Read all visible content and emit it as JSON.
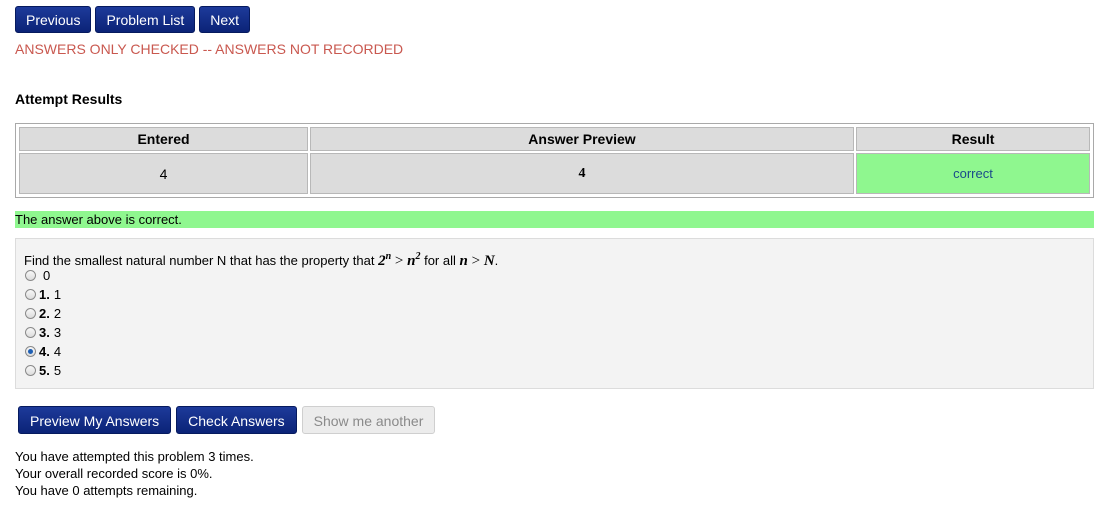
{
  "nav": {
    "previous_label": "Previous",
    "problem_list_label": "Problem List",
    "next_label": "Next"
  },
  "warning_text": "ANSWERS ONLY CHECKED -- ANSWERS NOT RECORDED",
  "results": {
    "title": "Attempt Results",
    "headers": {
      "entered": "Entered",
      "preview": "Answer Preview",
      "result": "Result"
    },
    "row": {
      "entered": "4",
      "preview": "4",
      "result": "correct"
    }
  },
  "correct_banner": "The answer above is correct.",
  "problem": {
    "prompt_before": "Find the smallest natural number N that has the property that",
    "prompt_middle": "for all",
    "math1_base": "2",
    "math1_exp": "n",
    "math1_op": ">",
    "math1_rhs_base": "n",
    "math1_rhs_exp": "2",
    "math2_lhs": "n",
    "math2_op": ">",
    "math2_rhs": "N",
    "prompt_end": ".",
    "choices": [
      {
        "num": "",
        "label": "0",
        "checked": false
      },
      {
        "num": "1.",
        "label": "1",
        "checked": false
      },
      {
        "num": "2.",
        "label": "2",
        "checked": false
      },
      {
        "num": "3.",
        "label": "3",
        "checked": false
      },
      {
        "num": "4.",
        "label": "4",
        "checked": true
      },
      {
        "num": "5.",
        "label": "5",
        "checked": false
      }
    ]
  },
  "actions": {
    "preview_label": "Preview My Answers",
    "check_label": "Check Answers",
    "show_another_label": "Show me another"
  },
  "status": {
    "line1": "You have attempted this problem 3 times.",
    "line2": "Your overall recorded score is 0%.",
    "line3": "You have 0 attempts remaining."
  },
  "colors": {
    "button_blue": "#0b2377",
    "warning_red": "#c9584f",
    "correct_green": "#8ff78f"
  }
}
